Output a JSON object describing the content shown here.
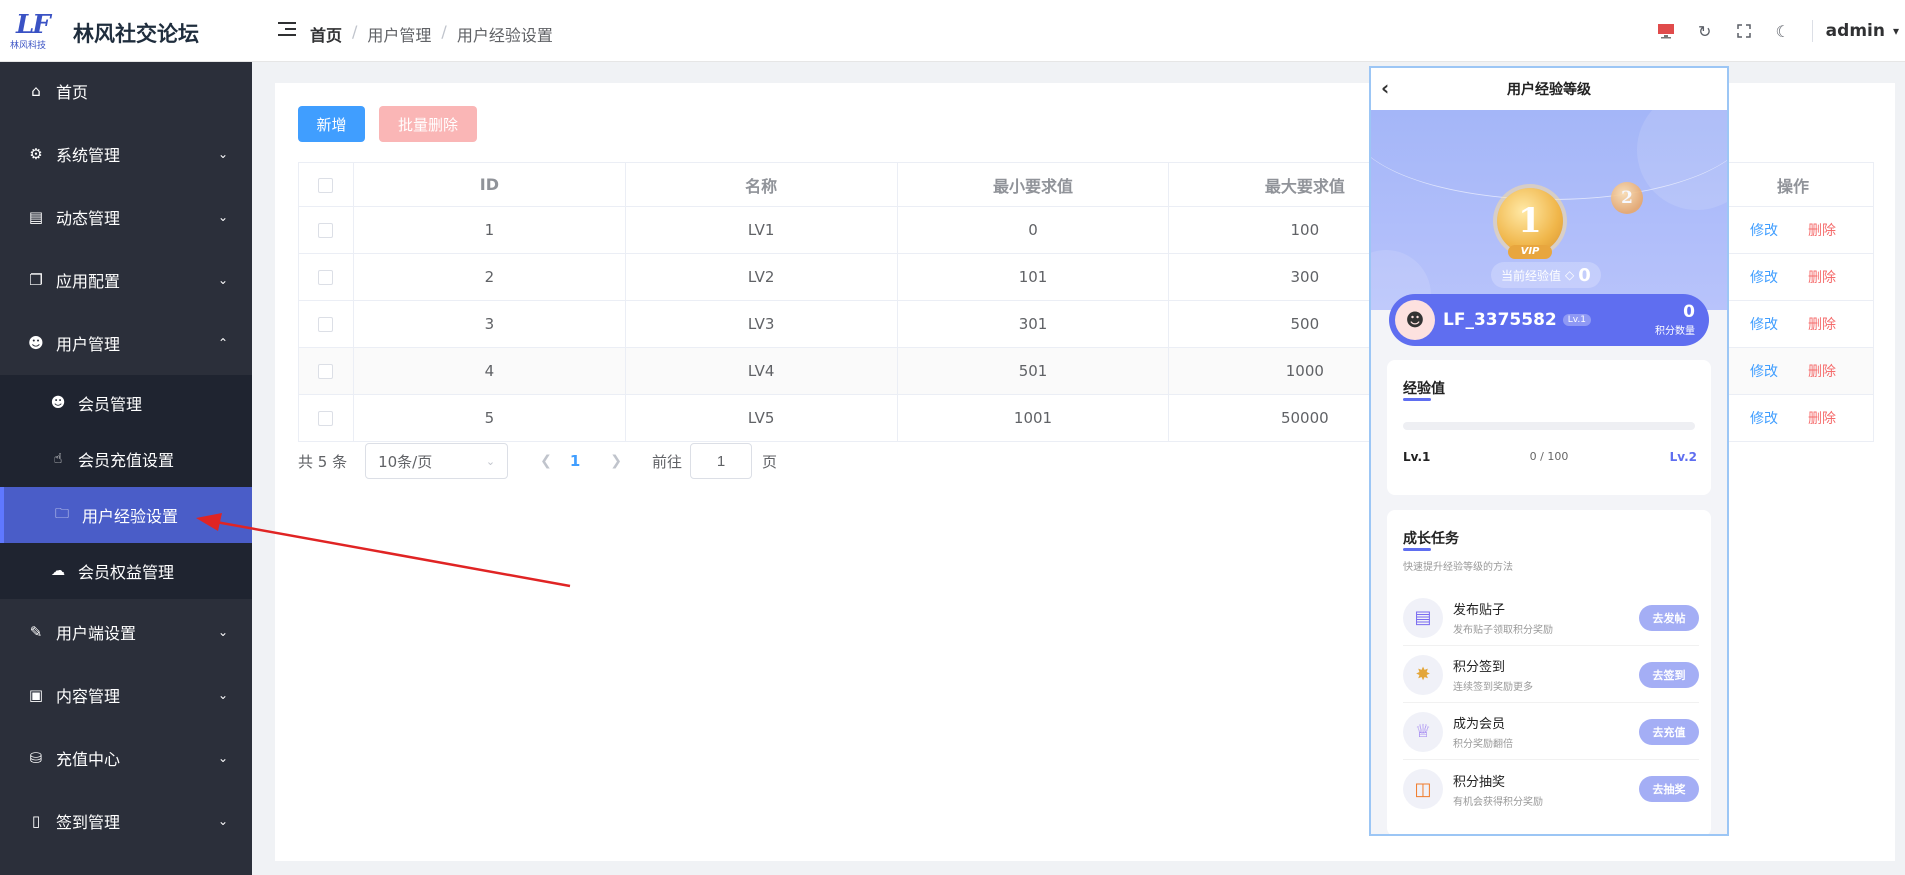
{
  "header": {
    "logo_text": "LF",
    "logo_sub": "林风科技",
    "site_title": "林风社交论坛",
    "breadcrumb": [
      "首页",
      "用户管理",
      "用户经验设置"
    ],
    "username": "admin"
  },
  "sidebar": {
    "items": [
      {
        "label": "首页",
        "icon": "home-icon"
      },
      {
        "label": "系统管理",
        "icon": "gear-icon"
      },
      {
        "label": "动态管理",
        "icon": "message-icon"
      },
      {
        "label": "应用配置",
        "icon": "copy-icon"
      },
      {
        "label": "用户管理",
        "icon": "user-icon"
      },
      {
        "label": "用户端设置",
        "icon": "edit-icon"
      },
      {
        "label": "内容管理",
        "icon": "card-icon"
      },
      {
        "label": "充值中心",
        "icon": "coins-icon"
      },
      {
        "label": "签到管理",
        "icon": "phone-icon"
      }
    ],
    "sub_items": [
      {
        "label": "会员管理",
        "icon": "user-icon"
      },
      {
        "label": "会员充值设置",
        "icon": "pointer-icon"
      },
      {
        "label": "用户经验设置",
        "icon": "folder-icon"
      },
      {
        "label": "会员权益管理",
        "icon": "cloud-icon"
      }
    ]
  },
  "toolbar": {
    "add_label": "新增",
    "batch_delete_label": "批量删除"
  },
  "table": {
    "headers": [
      "ID",
      "名称",
      "最小要求值",
      "最大要求值",
      "操作"
    ],
    "rows": [
      {
        "id": "1",
        "name": "LV1",
        "min": "0",
        "max": "100"
      },
      {
        "id": "2",
        "name": "LV2",
        "min": "101",
        "max": "300"
      },
      {
        "id": "3",
        "name": "LV3",
        "min": "301",
        "max": "500"
      },
      {
        "id": "4",
        "name": "LV4",
        "min": "501",
        "max": "1000"
      },
      {
        "id": "5",
        "name": "LV5",
        "min": "1001",
        "max": "50000"
      }
    ],
    "edit_label": "修改",
    "delete_label": "删除"
  },
  "pagination": {
    "total": "共 5 条",
    "page_size": "10条/页",
    "current_page": "1",
    "goto_label": "前往",
    "goto_value": "1",
    "page_suffix": "页"
  },
  "phone": {
    "title": "用户经验等级",
    "medal_main": "1",
    "medal_vip": "VIP",
    "medal_next": "2",
    "current_exp_label": "当前经验值",
    "current_exp_value": "0",
    "user_name": "LF_3375582",
    "user_level": "Lv.1",
    "points_value": "0",
    "points_label": "积分数量",
    "exp_title": "经验值",
    "exp_from": "Lv.1",
    "exp_progress": "0 / 100",
    "exp_to": "Lv.2",
    "tasks_title": "成长任务",
    "tasks_subtitle": "快速提升经验等级的方法",
    "tasks": [
      {
        "name": "发布贴子",
        "desc": "发布贴子领取积分奖励",
        "button": "去发帖",
        "icon": "document-icon"
      },
      {
        "name": "积分签到",
        "desc": "连续签到奖励更多",
        "button": "去签到",
        "icon": "medal-icon"
      },
      {
        "name": "成为会员",
        "desc": "积分奖励翻倍",
        "button": "去充值",
        "icon": "crown-icon"
      },
      {
        "name": "积分抽奖",
        "desc": "有机会获得积分奖励",
        "button": "去抽奖",
        "icon": "gift-icon"
      }
    ]
  },
  "colors": {
    "sidebar_bg": "#2b2f3a",
    "active_menu": "#4a5dc8",
    "primary": "#409eff",
    "danger": "#f56c6c",
    "annotation_arrow": "#e02424"
  }
}
